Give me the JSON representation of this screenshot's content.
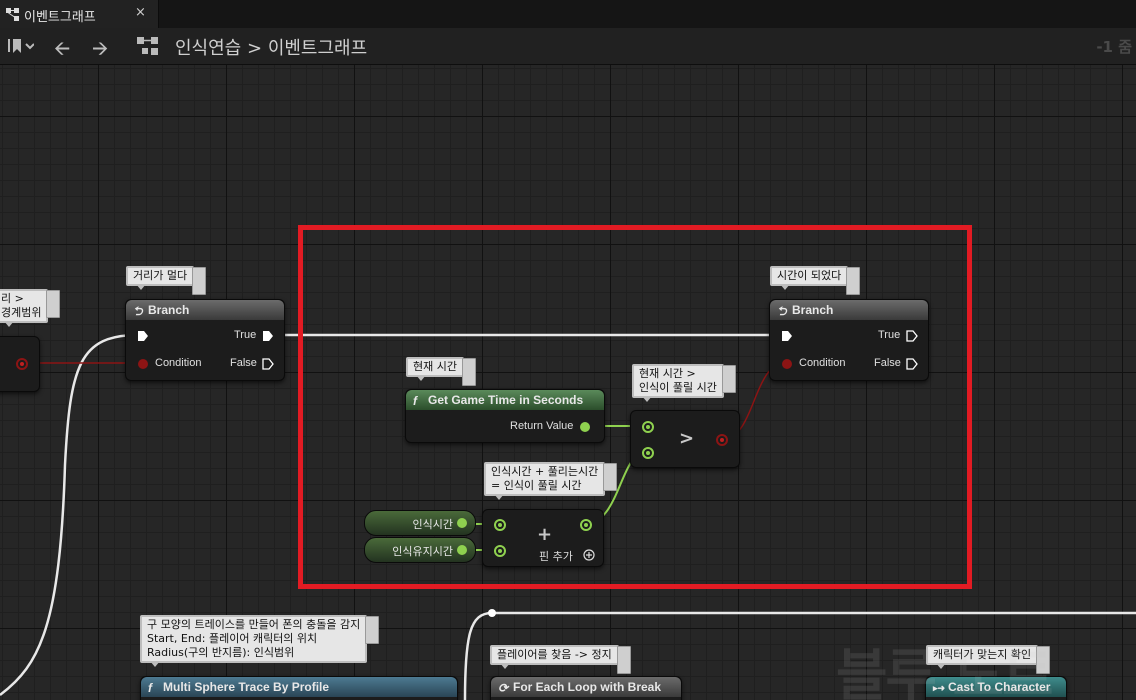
{
  "tab": {
    "title": "이벤트그래프",
    "close": "×"
  },
  "breadcrumb": {
    "root": "인식연습",
    "sep": ">",
    "current": "이벤트그래프"
  },
  "zoom": "-1 줌",
  "comments": {
    "left_partial": [
      "리 >",
      "경계범위"
    ],
    "far": "거리가 멀다",
    "time_reached": "시간이 되었다",
    "current_time": "현재 시간",
    "compare": [
      "현재 시간 >",
      "인식이 풀릴 시간"
    ],
    "sum": [
      "인식시간 + 풀리는시간",
      "= 인식이 풀릴 시간"
    ],
    "sphere": [
      "구 모양의 트레이스를 만들어 폰의 충돌을 감지",
      "Start, End: 플레이어 캐릭터의 위치",
      "Radius(구의 반지름): 인식범위"
    ],
    "found": "플레이어를 찾음 -> 정지",
    "check_char": "캐릭터가 맞는지 확인"
  },
  "nodes": {
    "branch_left": {
      "title": "Branch",
      "true": "True",
      "false": "False",
      "condition": "Condition"
    },
    "branch_right": {
      "title": "Branch",
      "true": "True",
      "false": "False",
      "condition": "Condition"
    },
    "get_time": {
      "title": "Get Game Time in Seconds",
      "ret": "Return Value"
    },
    "greater": {
      "op": ">"
    },
    "add": {
      "op": "+",
      "add_pin": "핀 추가"
    },
    "var_detect": "인식시간",
    "var_keep": "인식유지시간",
    "sphere_trace": "Multi Sphere Trace By Profile",
    "for_each": "For Each Loop with Break",
    "cast": "Cast To Character"
  },
  "colors": {
    "exec": "#ffffff",
    "float": "#8fd14f",
    "bool": "#8c1414",
    "highlight": "#e21b23"
  },
  "watermark": "블루 노트"
}
